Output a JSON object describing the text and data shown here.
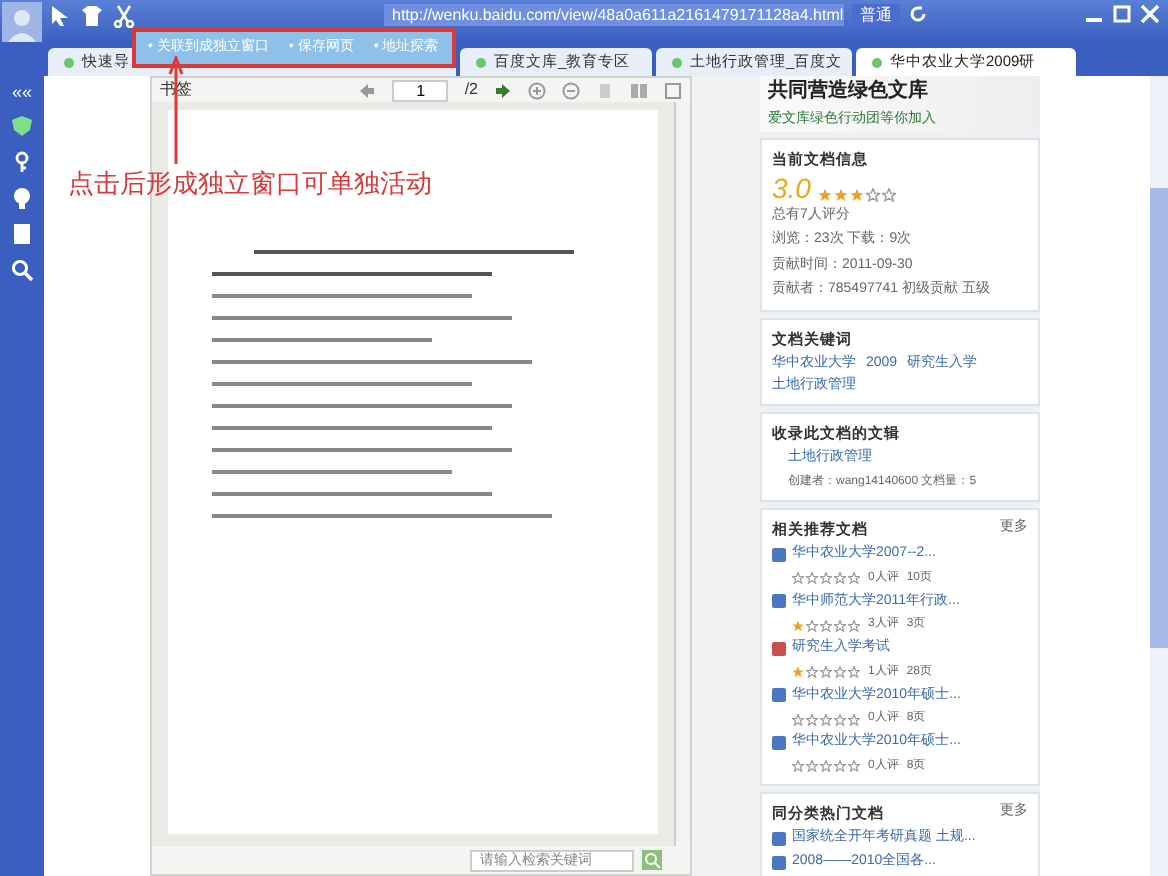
{
  "address_bar": {
    "url": "http://wenku.baidu.com/view/48a0a611a2161479171128a4.html",
    "mode": "普通"
  },
  "tabs": [
    {
      "label": "快速导",
      "selected": false
    },
    {
      "label": "百度文库_教育专区",
      "selected": false
    },
    {
      "label": "土地行政管理_百度文",
      "selected": false
    },
    {
      "label": "华中农业大学2009研",
      "selected": true
    }
  ],
  "sidebar": {
    "collapse": "««"
  },
  "popup_menu": {
    "items": [
      "• 关联到成独立窗口",
      "• 保存网页",
      "• 地址探索"
    ]
  },
  "annotation": {
    "text": "点击后形成独立窗口可单独活动"
  },
  "viewer": {
    "bookmark": "书签",
    "page": "1",
    "total": "/2",
    "search_placeholder": "请输入检索关键词"
  },
  "banner": {
    "title": "共同营造绿色文库",
    "subtitle": "爱文库绿色行动团等你加入"
  },
  "doc_info": {
    "title": "当前文档信息",
    "score": "3.0",
    "stars": 3,
    "ratings": "总有7人评分",
    "stats": "浏览：23次  下载：9次",
    "date": "贡献时间：2011-09-30",
    "contributor": "贡献者：785497741  初级贡献 五级"
  },
  "keywords": {
    "title": "文档关键词",
    "items": [
      "华中农业大学",
      "2009",
      "研究生入学",
      "土地行政管理"
    ]
  },
  "collections": {
    "title": "收录此文档的文辑",
    "name": "土地行政管理",
    "meta": "创建者：wang14140600  文档量：5"
  },
  "related": {
    "title": "相关推荐文档",
    "more": "更多",
    "items": [
      {
        "kind": "doc",
        "title": "华中农业大学2007--2...",
        "stars": 0,
        "ratings": "0人评",
        "pages": "10页"
      },
      {
        "kind": "doc",
        "title": "华中师范大学2011年行政...",
        "stars": 1,
        "ratings": "3人评",
        "pages": "3页"
      },
      {
        "kind": "pdf",
        "title": "研究生入学考试",
        "stars": 1,
        "ratings": "1人评",
        "pages": "28页"
      },
      {
        "kind": "doc",
        "title": "华中农业大学2010年硕士...",
        "stars": 0,
        "ratings": "0人评",
        "pages": "8页"
      },
      {
        "kind": "doc",
        "title": "华中农业大学2010年硕士...",
        "stars": 0,
        "ratings": "0人评",
        "pages": "8页"
      }
    ]
  },
  "popular": {
    "title": "同分类热门文档",
    "more": "更多",
    "items": [
      {
        "kind": "doc",
        "title": "国家统全开年考研真题 土规..."
      },
      {
        "kind": "doc",
        "title": "2008——2010全国各..."
      }
    ]
  }
}
